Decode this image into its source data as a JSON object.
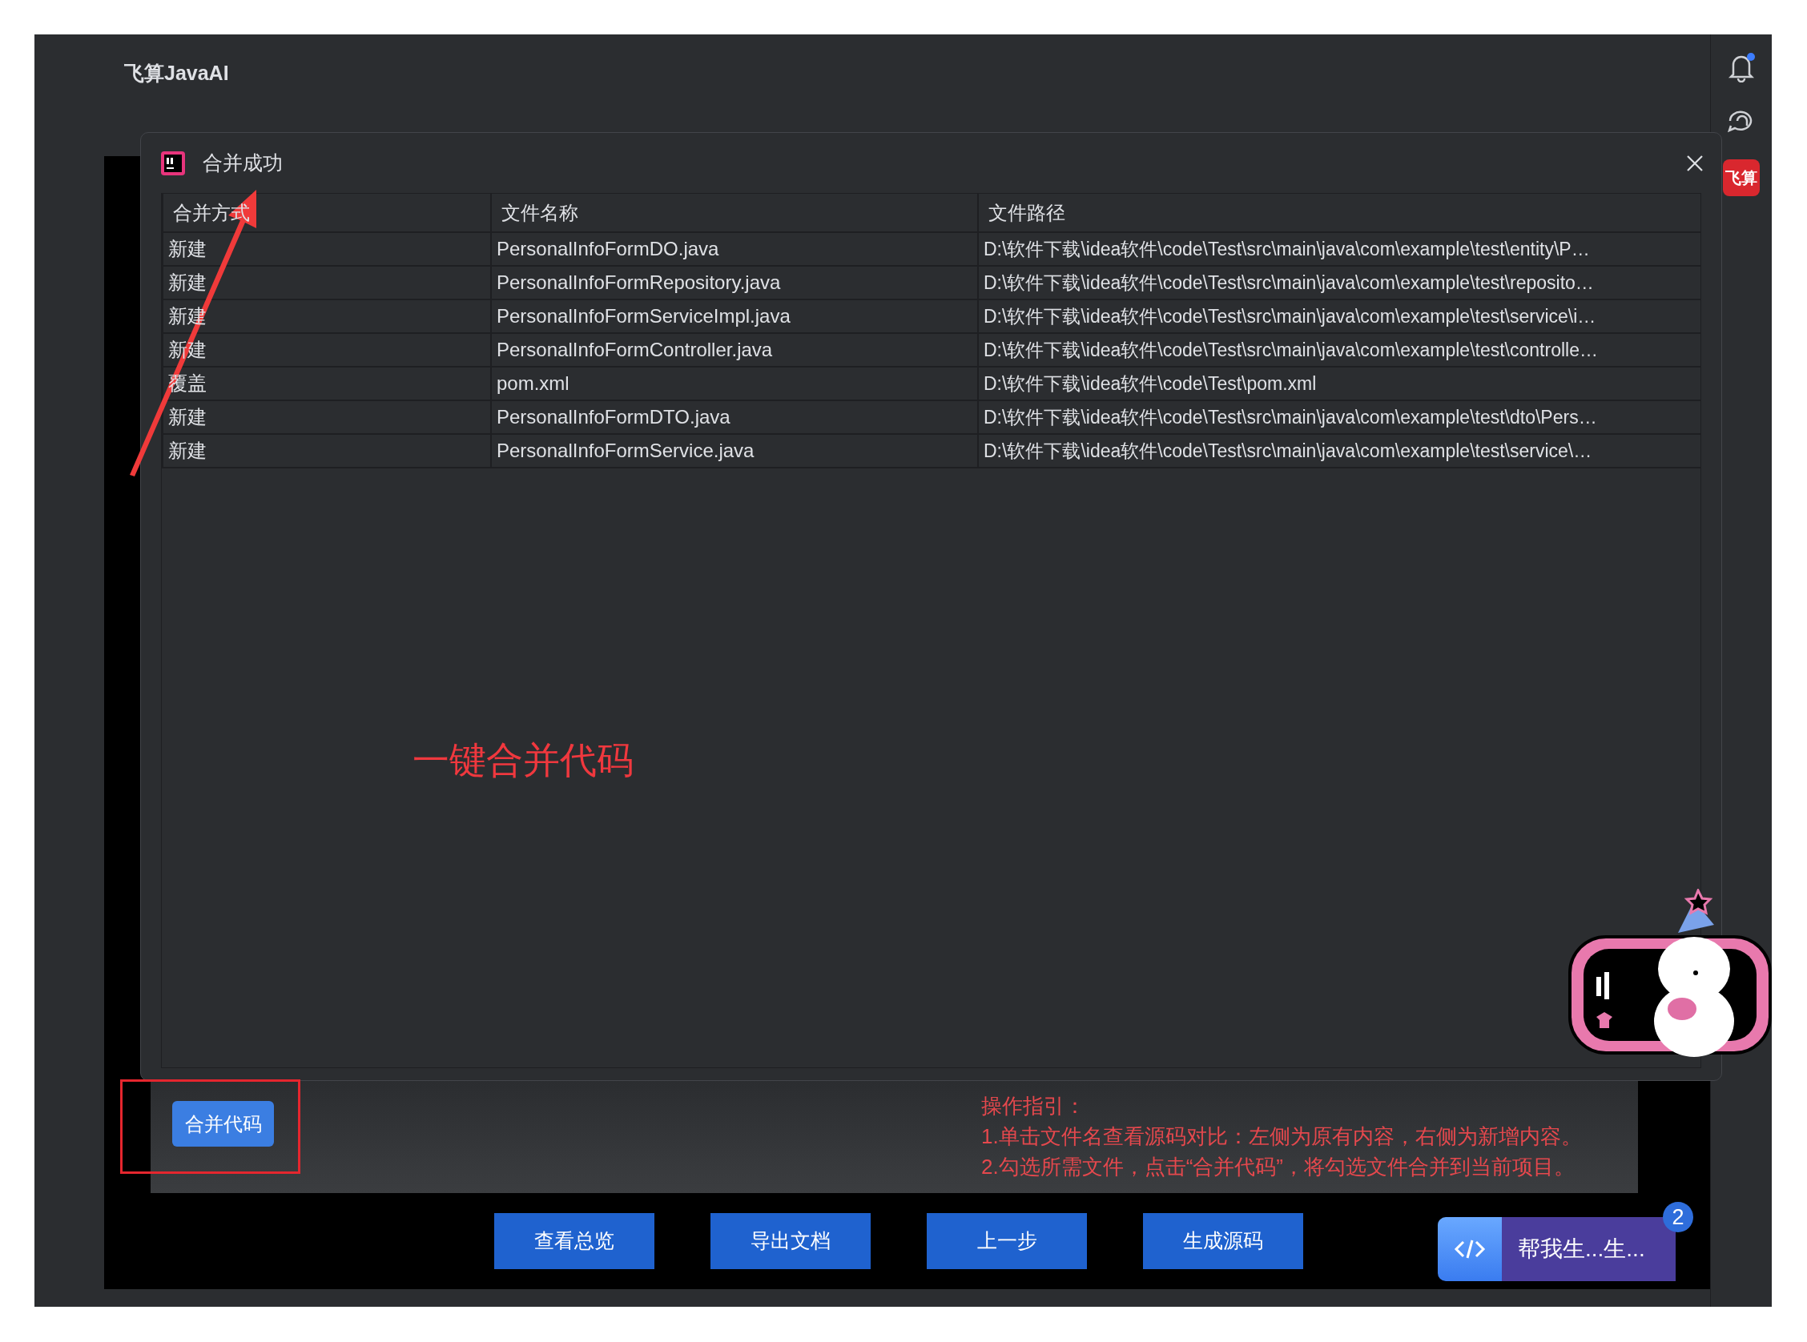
{
  "app": {
    "title": "飞算JavaAI",
    "logo": "飞算"
  },
  "dialog": {
    "title": "合并成功",
    "columns": [
      "合并方式",
      "文件名称",
      "文件路径"
    ],
    "rows": [
      {
        "cells": [
          "新建",
          "PersonalInfoFormDO.java",
          "D:\\软件下载\\idea软件\\code\\Test\\src\\main\\java\\com\\example\\test\\entity\\P…"
        ]
      },
      {
        "cells": [
          "新建",
          "PersonalInfoFormRepository.java",
          "D:\\软件下载\\idea软件\\code\\Test\\src\\main\\java\\com\\example\\test\\reposito…"
        ]
      },
      {
        "cells": [
          "新建",
          "PersonalInfoFormServiceImpl.java",
          "D:\\软件下载\\idea软件\\code\\Test\\src\\main\\java\\com\\example\\test\\service\\i…"
        ]
      },
      {
        "cells": [
          "新建",
          "PersonalInfoFormController.java",
          "D:\\软件下载\\idea软件\\code\\Test\\src\\main\\java\\com\\example\\test\\controlle…"
        ]
      },
      {
        "cells": [
          "覆盖",
          "pom.xml",
          "D:\\软件下载\\idea软件\\code\\Test\\pom.xml"
        ]
      },
      {
        "cells": [
          "新建",
          "PersonalInfoFormDTO.java",
          "D:\\软件下载\\idea软件\\code\\Test\\src\\main\\java\\com\\example\\test\\dto\\Pers…"
        ]
      },
      {
        "cells": [
          "新建",
          "PersonalInfoFormService.java",
          "D:\\软件下载\\idea软件\\code\\Test\\src\\main\\java\\com\\example\\test\\service\\…"
        ]
      }
    ]
  },
  "merge_button": "合并代码",
  "guide": {
    "heading": "操作指引：",
    "lines": [
      "1.单击文件名查看源码对比：左侧为原有内容，右侧为新增内容。",
      "2.勾选所需文件，点击“合并代码”，将勾选文件合并到当前项目。"
    ]
  },
  "footer_buttons": [
    "查看总览",
    "导出文档",
    "上一步",
    "生成源码"
  ],
  "chat": {
    "label": "帮我生...生...",
    "badge": "2"
  },
  "annotation": {
    "text": "一键合并代码"
  }
}
